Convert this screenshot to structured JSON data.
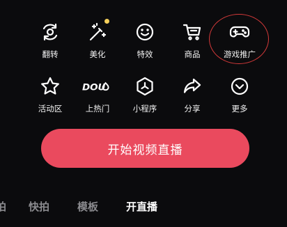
{
  "colors": {
    "background": "#0b0b0d",
    "accent": "#ea4a5e",
    "badge_dot": "#f4cf5a",
    "highlight_ring": "#d63a3a",
    "tab_active": "#ffffff",
    "tab_inactive": "#8a8a8e"
  },
  "tools_row1": [
    {
      "label": "翻转",
      "icon": "flip-camera-icon"
    },
    {
      "label": "美化",
      "icon": "magic-wand-icon",
      "has_dot": true
    },
    {
      "label": "特效",
      "icon": "smiley-face-icon"
    },
    {
      "label": "商品",
      "icon": "shopping-cart-icon"
    },
    {
      "label": "游戏推广",
      "icon": "gamepad-icon"
    }
  ],
  "tools_row2": [
    {
      "label": "活动区",
      "icon": "star-icon"
    },
    {
      "label": "上热门",
      "icon": "dou-plus-icon",
      "icon_text": "DOU"
    },
    {
      "label": "小程序",
      "icon": "mini-program-icon"
    },
    {
      "label": "分享",
      "icon": "share-arrow-icon"
    },
    {
      "label": "更多",
      "icon": "more-chevron-icon"
    }
  ],
  "start_button": {
    "label": "开始视频直播"
  },
  "tabs": [
    {
      "label": "拍",
      "active": false
    },
    {
      "label": "快拍",
      "active": false
    },
    {
      "label": "模板",
      "active": false
    },
    {
      "label": "开直播",
      "active": true
    }
  ]
}
